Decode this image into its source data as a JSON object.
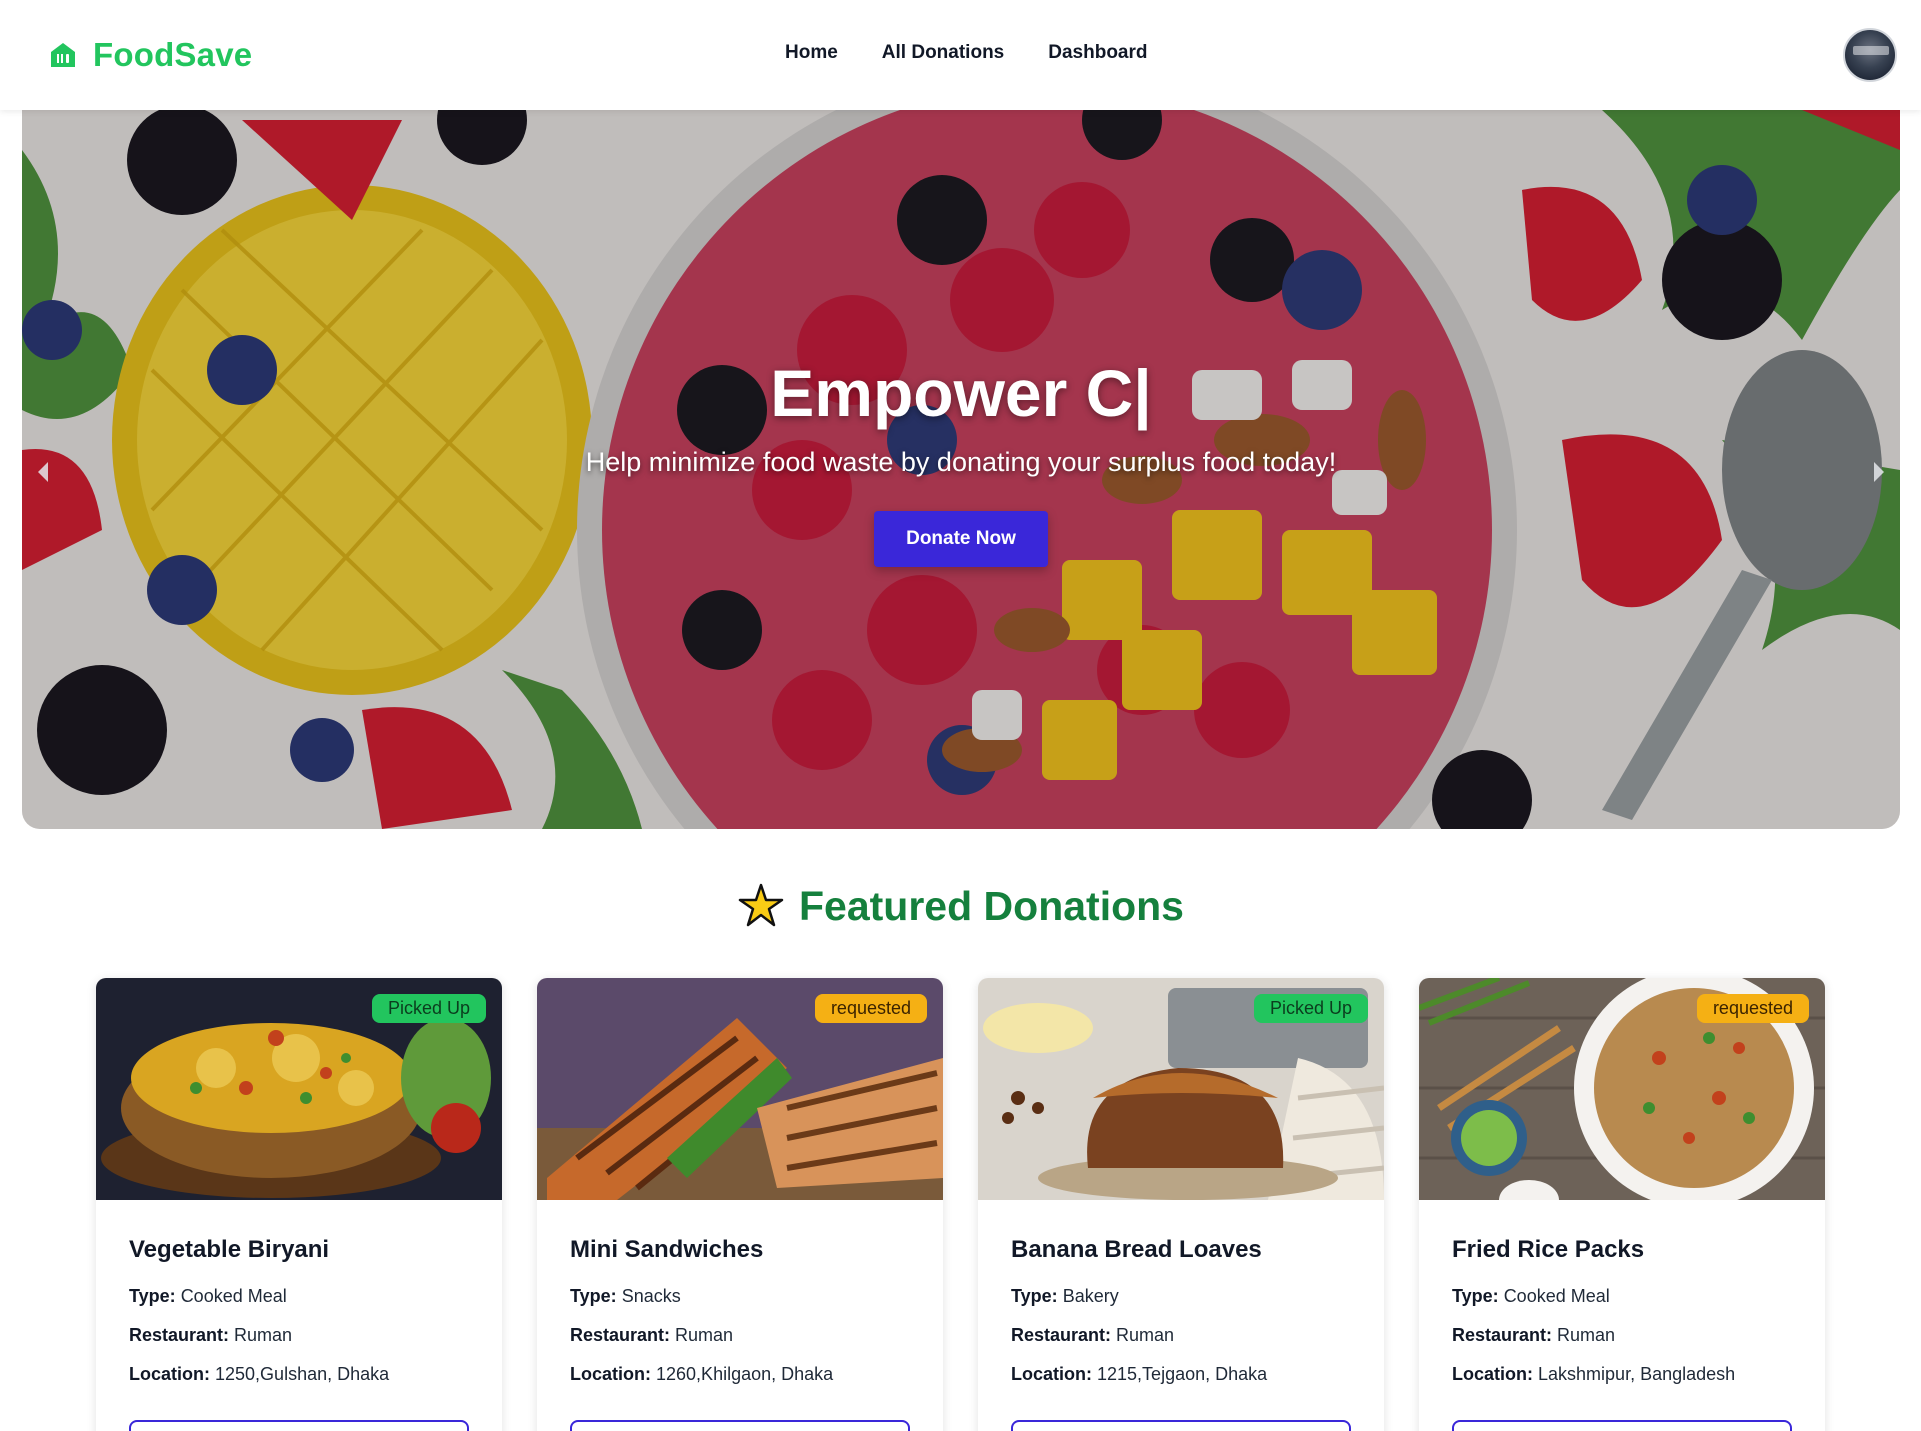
{
  "navbar": {
    "brand": "FoodSave",
    "links": [
      "Home",
      "All Donations",
      "Dashboard"
    ]
  },
  "hero": {
    "title": "Empower C|",
    "subtitle": "Help minimize food waste by donating your surplus food today!",
    "cta_label": "Donate Now"
  },
  "featured": {
    "title": "Featured Donations"
  },
  "labels": {
    "type": "Type:",
    "restaurant": "Restaurant:",
    "location": "Location:"
  },
  "donations": [
    {
      "name": "Vegetable Biryani",
      "type": "Cooked Meal",
      "restaurant": "Ruman",
      "location": "1250,Gulshan, Dhaka",
      "status": "Picked Up"
    },
    {
      "name": "Mini Sandwiches",
      "type": "Snacks",
      "restaurant": "Ruman",
      "location": "1260,Khilgaon, Dhaka",
      "status": "requested"
    },
    {
      "name": "Banana Bread Loaves",
      "type": "Bakery",
      "restaurant": "Ruman",
      "location": "1215,Tejgaon, Dhaka",
      "status": "Picked Up"
    },
    {
      "name": "Fried Rice Packs",
      "type": "Cooked Meal",
      "restaurant": "Ruman",
      "location": "Lakshmipur, Bangladesh",
      "status": "requested"
    }
  ],
  "colors": {
    "brand_green": "#22c55e",
    "heading_green": "#15803d",
    "primary": "#3a27d9",
    "badge_picked": "#22c55e",
    "badge_requested": "#f5b014"
  },
  "icons": {
    "brand": "store-icon",
    "featured": "star-icon",
    "prev": "chevron-left-icon",
    "next": "chevron-right-icon"
  }
}
